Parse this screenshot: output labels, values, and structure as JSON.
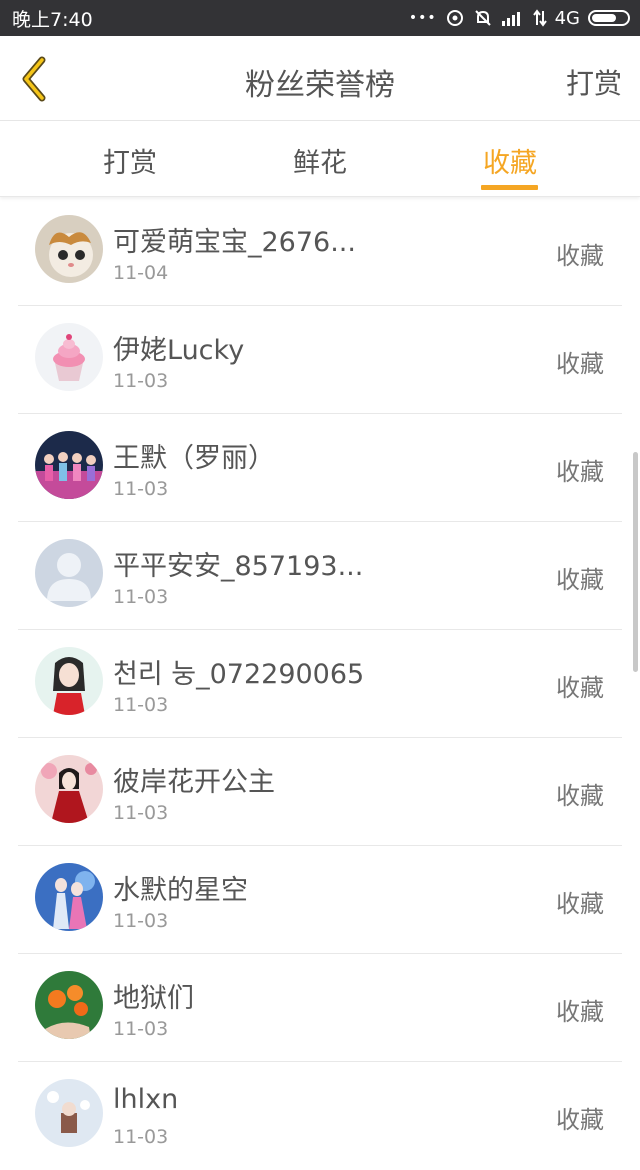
{
  "status_bar": {
    "time": "晚上7:40",
    "network": "4G",
    "dots": "•••"
  },
  "header": {
    "title": "粉丝荣誉榜",
    "action_label": "打赏",
    "accent_color": "#F5A623"
  },
  "tabs": [
    {
      "label": "打赏",
      "active": false
    },
    {
      "label": "鲜花",
      "active": false
    },
    {
      "label": "收藏",
      "active": true
    }
  ],
  "fans": [
    {
      "name": "可爱萌宝宝_2676...",
      "date": "11-04",
      "type": "收藏",
      "avatar": "kitten-avatar"
    },
    {
      "name": "伊姥Lucky",
      "date": "11-03",
      "type": "收藏",
      "avatar": "cupcake-avatar"
    },
    {
      "name": "王默（罗丽）",
      "date": "11-03",
      "type": "收藏",
      "avatar": "group-photo-avatar"
    },
    {
      "name": "平平安安_857193...",
      "date": "11-03",
      "type": "收藏",
      "avatar": "default-user-avatar"
    },
    {
      "name": "천리 눙_072290065",
      "date": "11-03",
      "type": "收藏",
      "avatar": "anime-girl-avatar"
    },
    {
      "name": "彼岸花开公主",
      "date": "11-03",
      "type": "收藏",
      "avatar": "red-dress-avatar"
    },
    {
      "name": "水默的星空",
      "date": "11-03",
      "type": "收藏",
      "avatar": "blue-fantasy-avatar"
    },
    {
      "name": "地狱们",
      "date": "11-03",
      "type": "收藏",
      "avatar": "orange-flowers-avatar"
    },
    {
      "name": "lhlxn",
      "date": "11-03",
      "type": "收藏",
      "avatar": "winter-doll-avatar"
    }
  ]
}
